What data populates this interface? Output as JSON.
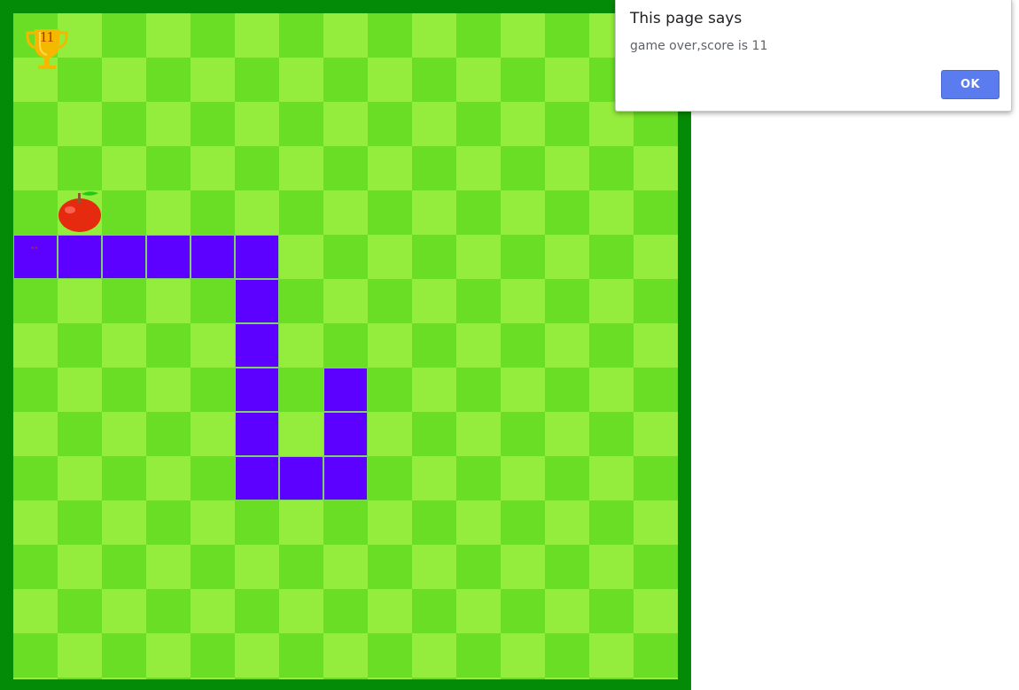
{
  "game": {
    "score": "11",
    "colors": {
      "frame": "#038a06",
      "tile_light": "#94ec3c",
      "tile_dark": "#6ade24",
      "snake": "#5c00ff",
      "apple": "#e62a10",
      "trophy": "#f5b800"
    },
    "grid": {
      "cols": 15,
      "rows": 15
    },
    "snake_cells": [
      [
        0,
        5
      ],
      [
        1,
        5
      ],
      [
        2,
        5
      ],
      [
        3,
        5
      ],
      [
        4,
        5
      ],
      [
        5,
        5
      ],
      [
        5,
        6
      ],
      [
        5,
        7
      ],
      [
        5,
        8
      ],
      [
        5,
        9
      ],
      [
        5,
        10
      ],
      [
        6,
        10
      ],
      [
        7,
        10
      ],
      [
        7,
        9
      ],
      [
        7,
        8
      ]
    ],
    "snake_head_cell": [
      0,
      5
    ],
    "apple_cell": [
      1,
      4
    ],
    "icons": {
      "trophy": "trophy-icon",
      "apple": "apple-icon"
    }
  },
  "dialog": {
    "title": "This page says",
    "message": "game over,score is 11",
    "ok_label": "OK"
  }
}
